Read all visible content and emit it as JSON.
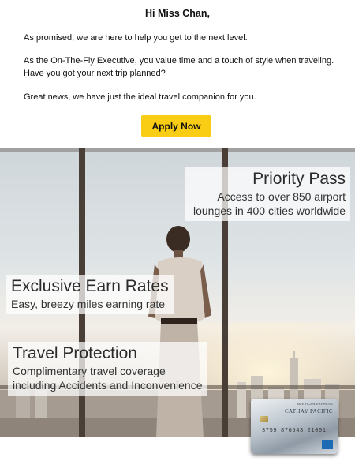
{
  "email": {
    "greeting": "Hi Miss Chan,",
    "paragraph_1": "As promised, we are here to help you get to the next level.",
    "paragraph_2": "As the On-The-Fly Executive, you value time and a touch of style when traveling. Have you got your next trip planned?",
    "paragraph_3": "Great news, we have just the ideal travel companion for you.",
    "cta_label": "Apply Now"
  },
  "banner": {
    "priority_pass": {
      "title": "Priority Pass",
      "line_1": "Access to over 850 airport",
      "line_2": "lounges in 400 cities worldwide"
    },
    "earn_rates": {
      "title": "Exclusive Earn Rates",
      "subtitle": "Easy, breezy miles earning rate"
    },
    "travel_protection": {
      "title": "Travel Protection",
      "line_1": "Complimentary travel coverage",
      "line_2": "including Accidents and Inconvenience"
    }
  },
  "card": {
    "issuer": "AMERICAN EXPRESS",
    "brand": "CATHAY PACIFIC",
    "number": "3759 876543 21001"
  },
  "colors": {
    "cta_background": "#f8cd14",
    "amex_blue": "#1d6bb5"
  }
}
